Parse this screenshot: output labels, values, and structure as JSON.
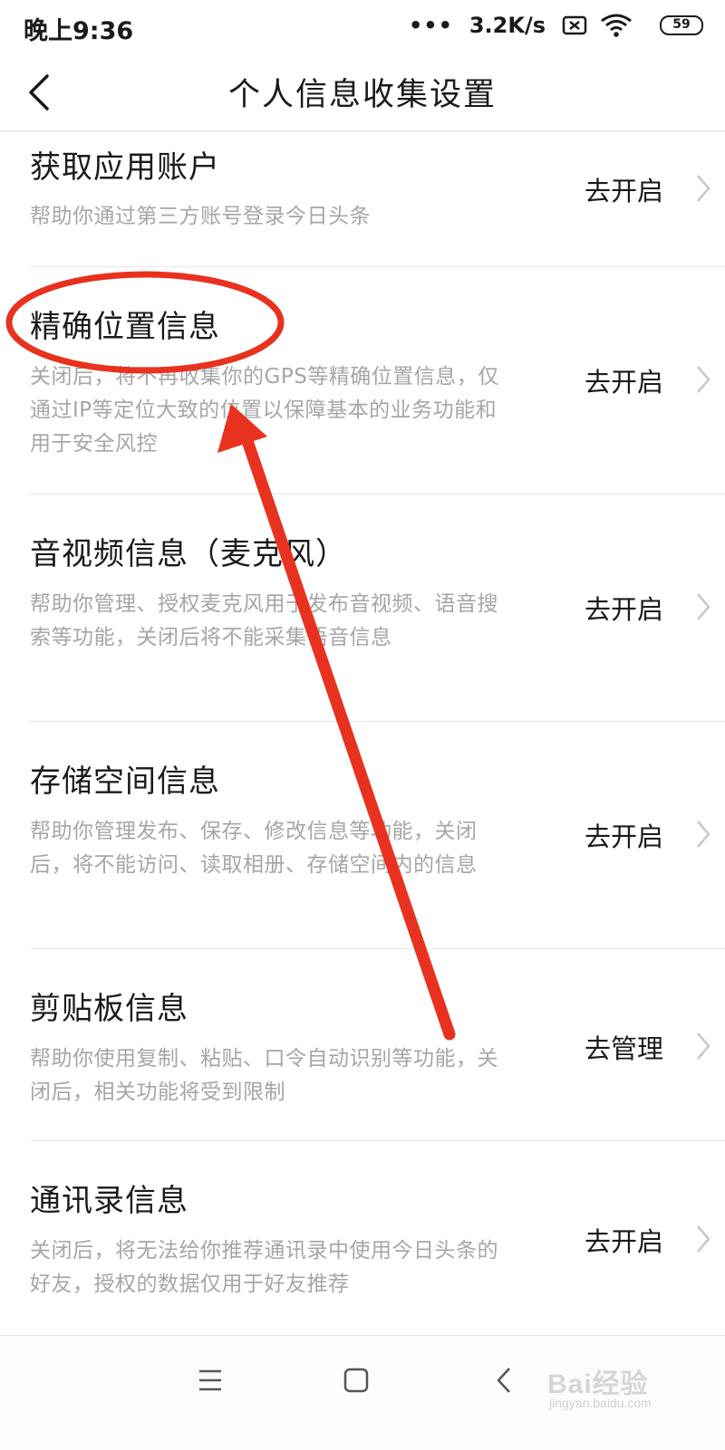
{
  "status_bar": {
    "time": "晚上9:36",
    "dots": "•••",
    "speed": "3.2K/s",
    "battery": "59",
    "icons": [
      "sim-off-icon",
      "wifi-icon",
      "battery-icon"
    ]
  },
  "header": {
    "title": "个人信息收集设置",
    "back_icon": "chevron-left-icon"
  },
  "items": [
    {
      "title": "获取应用账户",
      "desc": "帮助你通过第三方账号登录今日头条",
      "action": "去开启"
    },
    {
      "title": "精确位置信息",
      "desc": "关闭后，将不再收集你的GPS等精确位置信息，仅通过IP等定位大致的位置以保障基本的业务功能和用于安全风控",
      "action": "去开启"
    },
    {
      "title": "音视频信息（麦克风）",
      "desc": "帮助你管理、授权麦克风用于发布音视频、语音搜索等功能，关闭后将不能采集语音信息",
      "action": "去开启"
    },
    {
      "title": "存储空间信息",
      "desc": "帮助你管理发布、保存、修改信息等功能，关闭后，将不能访问、读取相册、存储空间内的信息",
      "action": "去开启"
    },
    {
      "title": "剪贴板信息",
      "desc": "帮助你使用复制、粘贴、口令自动识别等功能，关闭后，相关功能将受到限制",
      "action": "去管理"
    },
    {
      "title": "通讯录信息",
      "desc": "关闭后，将无法给你推荐通讯录中使用今日头条的好友，授权的数据仅用于好友推荐",
      "action": "去开启"
    }
  ],
  "nav_bar": {
    "icons": [
      "menu-icon",
      "home-icon",
      "back-icon"
    ],
    "watermark": "Bai经验",
    "watermark_sub": "jingyan.baidu.com"
  },
  "colors": {
    "annotation_red": "#e8321f",
    "secondary_text": "#a6a6a6",
    "divider": "#e8e8e8"
  }
}
